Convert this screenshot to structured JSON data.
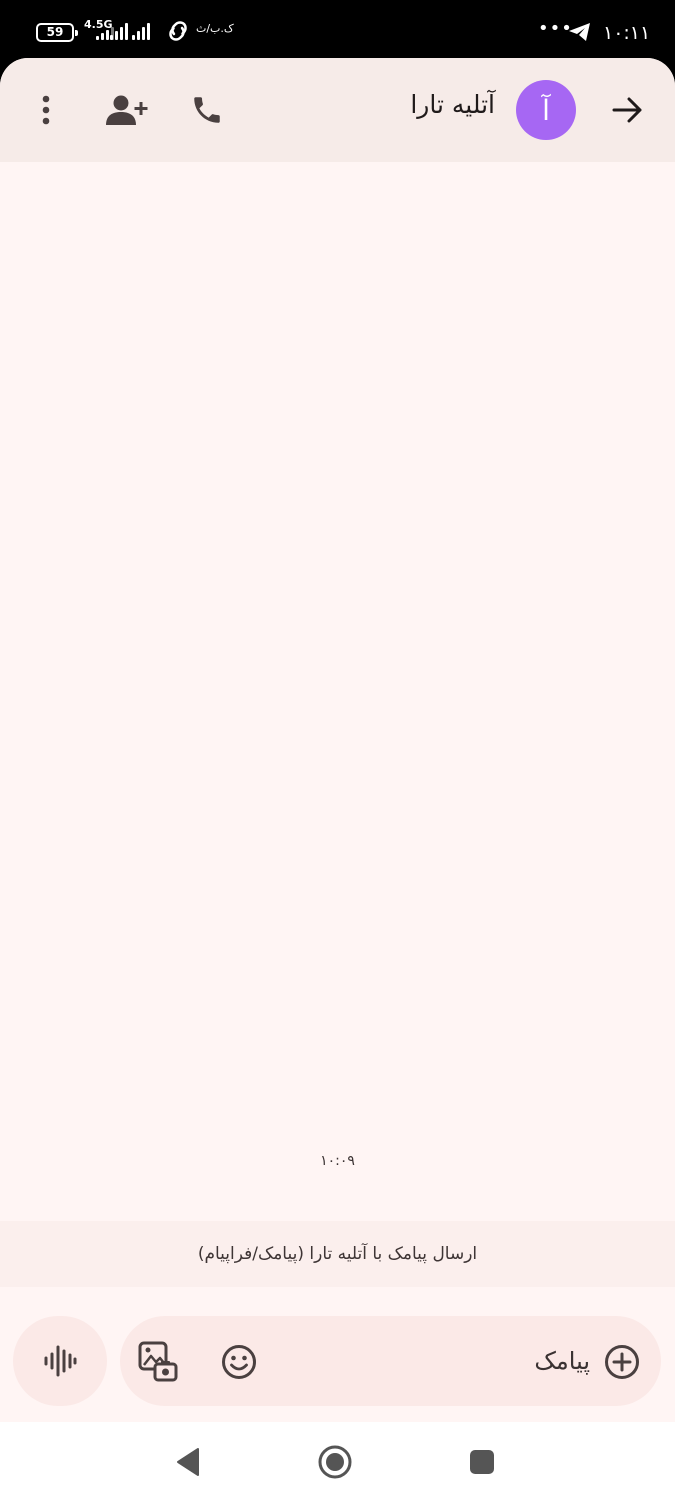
{
  "status_bar": {
    "battery": "59",
    "network_type": "4.5G",
    "carrier_text": "ک.ب/ث",
    "time": "۱۰:۱۱",
    "more_dots": "•••",
    "icons": [
      "battery-icon",
      "signal-icon",
      "vpn-icon",
      "telegram-icon"
    ]
  },
  "header": {
    "avatar_letter": "آ",
    "contact_name": "آتلیه تارا",
    "icons": [
      "back-arrow-icon",
      "call-icon",
      "add-contact-icon",
      "more-vert-icon"
    ]
  },
  "conversation": {
    "timestamp": "۱۰:۰۹"
  },
  "send_info": {
    "text": "ارسال پیامک با آتلیه تارا (پیامک/فراپیام)"
  },
  "compose": {
    "placeholder": "پیامک",
    "icons": [
      "add-circle-icon",
      "emoji-icon",
      "gallery-icon",
      "voice-waveform-icon"
    ]
  },
  "nav_bar": {
    "icons": [
      "nav-back-icon",
      "nav-home-icon",
      "nav-recents-icon"
    ]
  },
  "colors": {
    "background": "#fff5f4",
    "header": "#f6ebe8",
    "avatar": "#a667f3",
    "compose_bg": "#fbe9e7",
    "icon": "#4a4040"
  }
}
